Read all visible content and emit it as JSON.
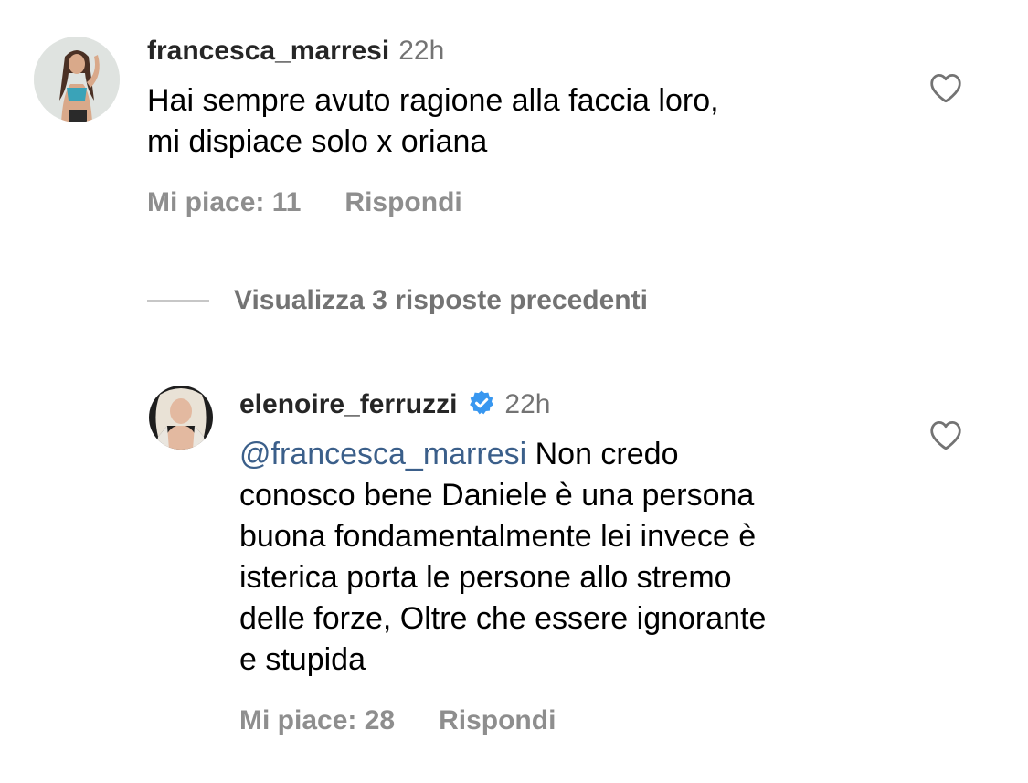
{
  "comments": [
    {
      "username": "francesca_marresi",
      "time": "22h",
      "verified": false,
      "text": "Hai sempre avuto ragione alla faccia loro,\nmi dispiace solo x oriana",
      "likes": "Mi piace: 11",
      "reply": "Rispondi"
    },
    {
      "username": "elenoire_ferruzzi",
      "time": "22h",
      "verified": true,
      "mention": "@francesca_marresi",
      "text": " Non credo\nconosco bene Daniele è una persona\nbuona fondamentalmente lei invece è\nisterica porta le persone allo stremo\ndelle forze, Oltre che essere ignorante\ne stupida",
      "likes": "Mi piace: 28",
      "reply": "Rispondi"
    }
  ],
  "view_replies": {
    "label": "Visualizza 3 risposte precedenti"
  },
  "icons": {
    "like": "heart-outline-icon",
    "verified": "verified-badge-icon"
  },
  "colors": {
    "verified_blue": "#3897f0",
    "mention": "#3b5f8a",
    "meta_gray": "#8e8e8e"
  }
}
